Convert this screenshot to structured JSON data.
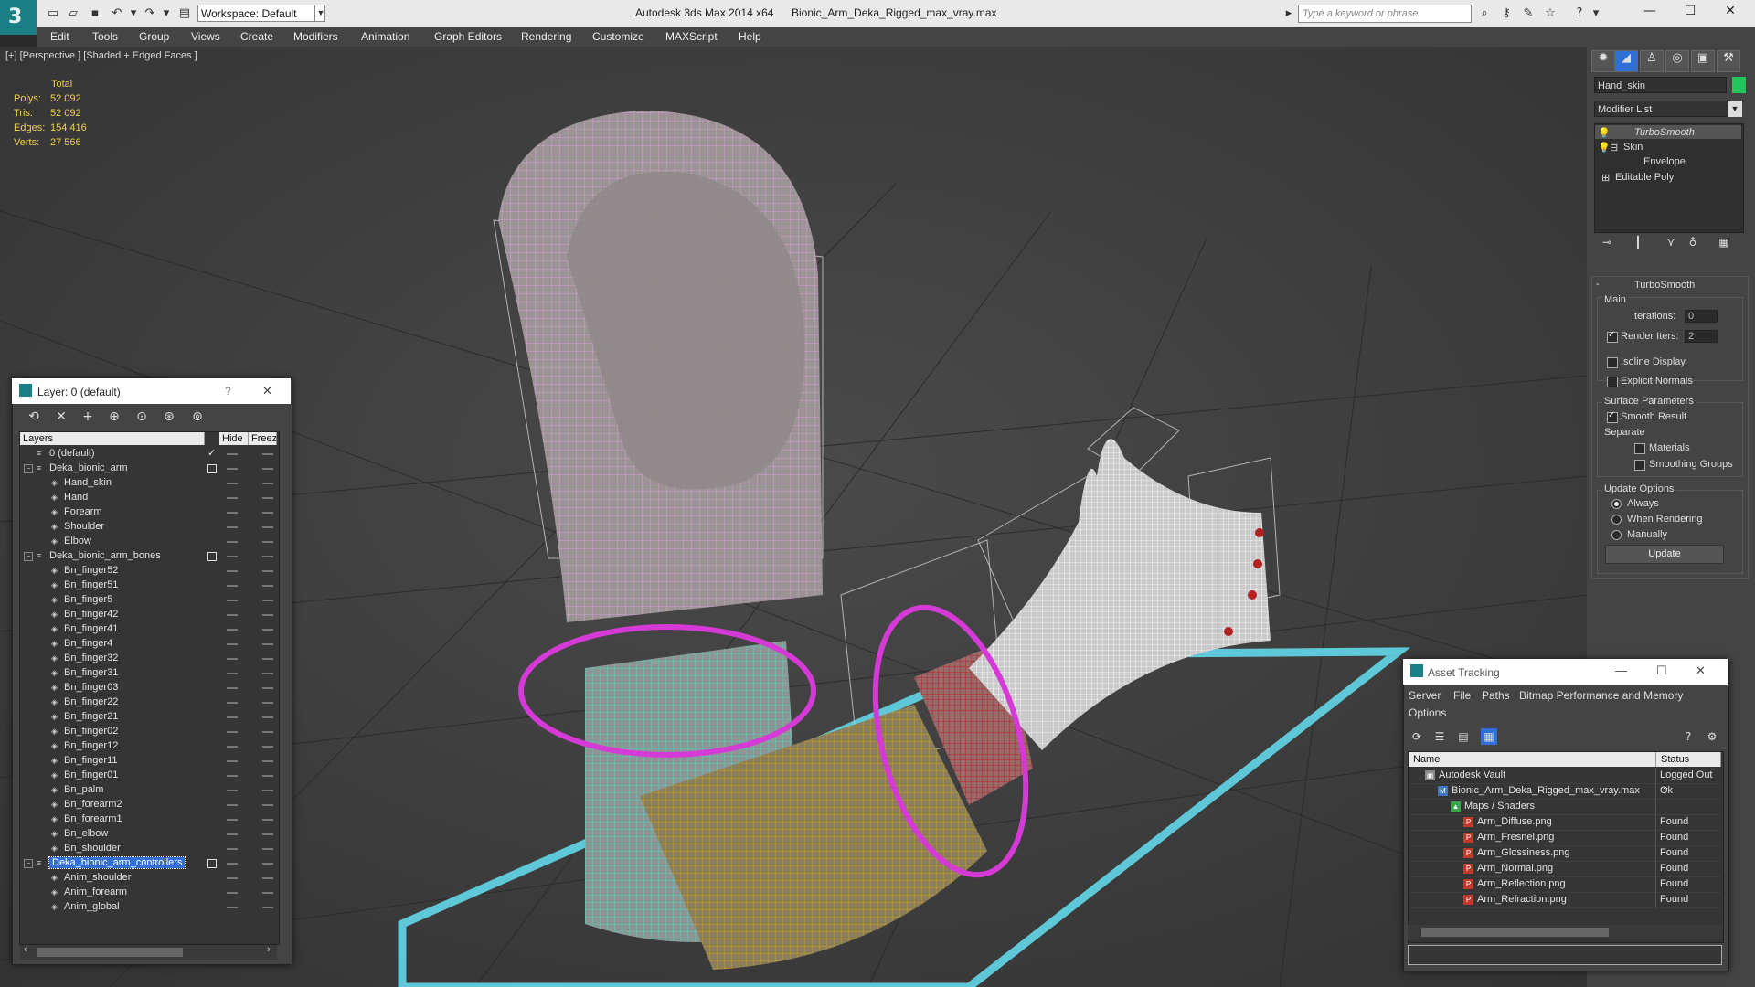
{
  "app": {
    "title": "Autodesk 3ds Max  2014 x64",
    "file": "Bionic_Arm_Deka_Rigged_max_vray.max",
    "workspace": "Workspace: Default",
    "search_placeholder": "Type a keyword or phrase",
    "logo_glyph": "3"
  },
  "menu": [
    "Edit",
    "Tools",
    "Group",
    "Views",
    "Create",
    "Modifiers",
    "Animation",
    "Graph Editors",
    "Rendering",
    "Customize",
    "MAXScript",
    "Help"
  ],
  "viewport": {
    "label": "[+] [Perspective ] [Shaded + Edged Faces ]",
    "stats": {
      "header": "Total",
      "rows": [
        {
          "label": "Polys:",
          "value": "52 092"
        },
        {
          "label": "Tris:",
          "value": "52 092"
        },
        {
          "label": "Edges:",
          "value": "154 416"
        },
        {
          "label": "Verts:",
          "value": "27 566"
        }
      ]
    }
  },
  "command_panel": {
    "object_name": "Hand_skin",
    "object_color": "#22c55e",
    "modifier_list": "Modifier List",
    "stack": [
      "TurboSmooth",
      "Skin",
      "Envelope",
      "Editable Poly"
    ],
    "rollout_title": "TurboSmooth",
    "main_label": "Main",
    "iterations_label": "Iterations:",
    "iterations_value": "0",
    "render_iters_label": "Render Iters:",
    "render_iters_value": "2",
    "isoline": "Isoline Display",
    "explicit_normals": "Explicit Normals",
    "surface_params": "Surface Parameters",
    "smooth_result": "Smooth Result",
    "separate": "Separate",
    "materials": "Materials",
    "smoothing_groups": "Smoothing Groups",
    "update_options": "Update Options",
    "always": "Always",
    "when_rendering": "When Rendering",
    "manually": "Manually",
    "update_button": "Update"
  },
  "layer_explorer": {
    "title": "Layer: 0 (default)",
    "help": "?",
    "close": "✕",
    "columns": [
      "Layers",
      "Hide",
      "Freez"
    ],
    "rows": [
      {
        "name": "0 (default)",
        "level": 1,
        "check": true
      },
      {
        "name": "Deka_bionic_arm",
        "level": 1,
        "group": true
      },
      {
        "name": "Hand_skin",
        "level": 2
      },
      {
        "name": "Hand",
        "level": 2
      },
      {
        "name": "Forearm",
        "level": 2
      },
      {
        "name": "Shoulder",
        "level": 2
      },
      {
        "name": "Elbow",
        "level": 2
      },
      {
        "name": "Deka_bionic_arm_bones",
        "level": 1,
        "group": true
      },
      {
        "name": "Bn_finger52",
        "level": 2
      },
      {
        "name": "Bn_finger51",
        "level": 2
      },
      {
        "name": "Bn_finger5",
        "level": 2
      },
      {
        "name": "Bn_finger42",
        "level": 2
      },
      {
        "name": "Bn_finger41",
        "level": 2
      },
      {
        "name": "Bn_finger4",
        "level": 2
      },
      {
        "name": "Bn_finger32",
        "level": 2
      },
      {
        "name": "Bn_finger31",
        "level": 2
      },
      {
        "name": "Bn_finger03",
        "level": 2
      },
      {
        "name": "Bn_finger22",
        "level": 2
      },
      {
        "name": "Bn_finger21",
        "level": 2
      },
      {
        "name": "Bn_finger02",
        "level": 2
      },
      {
        "name": "Bn_finger12",
        "level": 2
      },
      {
        "name": "Bn_finger11",
        "level": 2
      },
      {
        "name": "Bn_finger01",
        "level": 2
      },
      {
        "name": "Bn_palm",
        "level": 2
      },
      {
        "name": "Bn_forearm2",
        "level": 2
      },
      {
        "name": "Bn_forearm1",
        "level": 2
      },
      {
        "name": "Bn_elbow",
        "level": 2
      },
      {
        "name": "Bn_shoulder",
        "level": 2
      },
      {
        "name": "Deka_bionic_arm_controllers",
        "level": 1,
        "group": true,
        "selected": true
      },
      {
        "name": "Anim_shoulder",
        "level": 2
      },
      {
        "name": "Anim_forearm",
        "level": 2
      },
      {
        "name": "Anim_global",
        "level": 2
      }
    ]
  },
  "asset_tracking": {
    "title": "Asset Tracking",
    "menu": [
      "Server",
      "File",
      "Paths",
      "Bitmap Performance and Memory",
      "Options"
    ],
    "columns": [
      "Name",
      "Status"
    ],
    "rows": [
      {
        "name": "Autodesk Vault",
        "status": "Logged Out ...",
        "level": 0,
        "icon": "vault"
      },
      {
        "name": "Bionic_Arm_Deka_Rigged_max_vray.max",
        "status": "Ok",
        "level": 1,
        "icon": "max"
      },
      {
        "name": "Maps / Shaders",
        "status": "",
        "level": 2,
        "icon": "maps"
      },
      {
        "name": "Arm_Diffuse.png",
        "status": "Found",
        "level": 3,
        "icon": "png"
      },
      {
        "name": "Arm_Fresnel.png",
        "status": "Found",
        "level": 3,
        "icon": "png"
      },
      {
        "name": "Arm_Glossiness.png",
        "status": "Found",
        "level": 3,
        "icon": "png"
      },
      {
        "name": "Arm_Normal.png",
        "status": "Found",
        "level": 3,
        "icon": "png"
      },
      {
        "name": "Arm_Reflection.png",
        "status": "Found",
        "level": 3,
        "icon": "png"
      },
      {
        "name": "Arm_Refraction.png",
        "status": "Found",
        "level": 3,
        "icon": "png"
      }
    ]
  },
  "colors": {
    "accent": "#1c7f86",
    "selection": "#2f6fd6",
    "stats_text": "#f0d050",
    "wire_pink": "#e6a0e6",
    "wire_cyan": "#40e0d0",
    "wire_gold": "#d4a017",
    "wire_red": "#b22222",
    "controller_magenta": "#d63ad6",
    "ground_frame": "#5fc8d8"
  }
}
